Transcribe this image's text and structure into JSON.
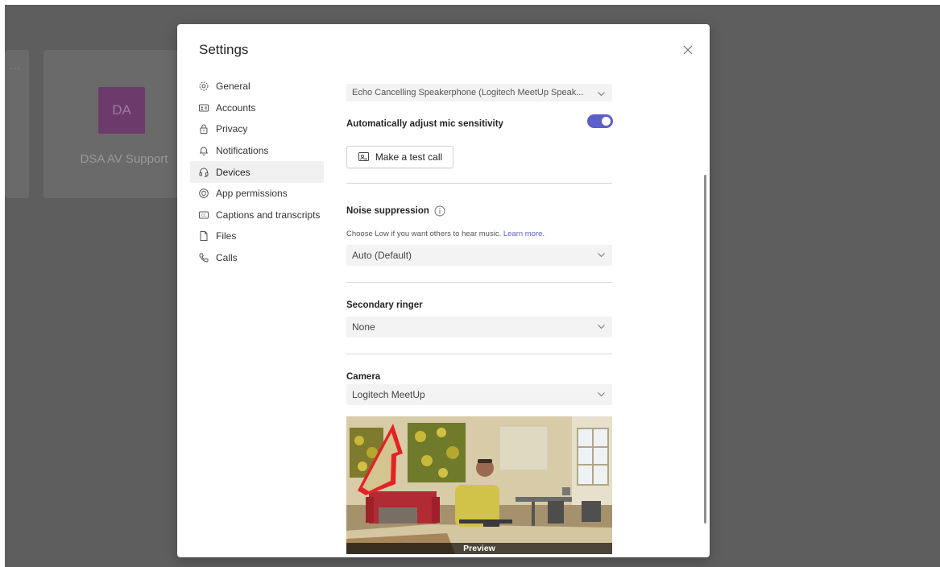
{
  "background": {
    "card_dots": "...",
    "avatar_initials": "DA",
    "card_name": "DSA AV Support"
  },
  "dialog": {
    "title": "Settings",
    "close_icon": "close-icon"
  },
  "nav": {
    "items": [
      {
        "label": "General",
        "icon": "gear-icon"
      },
      {
        "label": "Accounts",
        "icon": "id-card-icon"
      },
      {
        "label": "Privacy",
        "icon": "lock-icon"
      },
      {
        "label": "Notifications",
        "icon": "bell-icon"
      },
      {
        "label": "Devices",
        "icon": "headset-icon",
        "active": true
      },
      {
        "label": "App permissions",
        "icon": "shield-icon"
      },
      {
        "label": "Captions and transcripts",
        "icon": "cc-icon"
      },
      {
        "label": "Files",
        "icon": "file-icon"
      },
      {
        "label": "Calls",
        "icon": "phone-icon"
      }
    ]
  },
  "devices": {
    "microphone_value": "Echo Cancelling Speakerphone (Logitech MeetUp Speak...",
    "auto_mic_label": "Automatically adjust mic sensitivity",
    "auto_mic_on": true,
    "test_call_label": "Make a test call",
    "noise_label": "Noise suppression",
    "noise_hint": "Choose Low if you want others to hear music.",
    "noise_hint_link": "Learn more.",
    "noise_value": "Auto (Default)",
    "ringer_label": "Secondary ringer",
    "ringer_value": "None",
    "camera_label": "Camera",
    "camera_value": "Logitech MeetUp",
    "preview_label": "Preview"
  },
  "colors": {
    "accent": "#5b5fc7",
    "annotation_arrow": "#e01f1f",
    "overlay": "#5e5e5e"
  }
}
